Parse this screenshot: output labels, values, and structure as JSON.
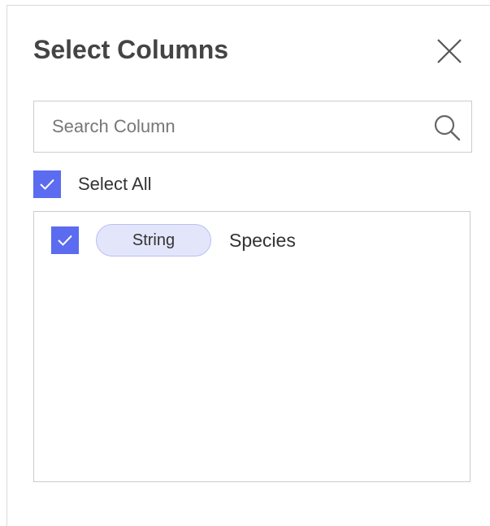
{
  "dialog": {
    "title": "Select Columns"
  },
  "search": {
    "placeholder": "Search Column",
    "value": ""
  },
  "select_all": {
    "label": "Select All",
    "checked": true
  },
  "columns": [
    {
      "type": "String",
      "name": "Species",
      "checked": true
    }
  ],
  "icons": {
    "close": "close-icon",
    "search": "search-icon",
    "check": "checkmark-icon"
  },
  "colors": {
    "accent": "#5b6cf0",
    "pill_background": "#e3e6fb",
    "title_text": "#444444"
  }
}
